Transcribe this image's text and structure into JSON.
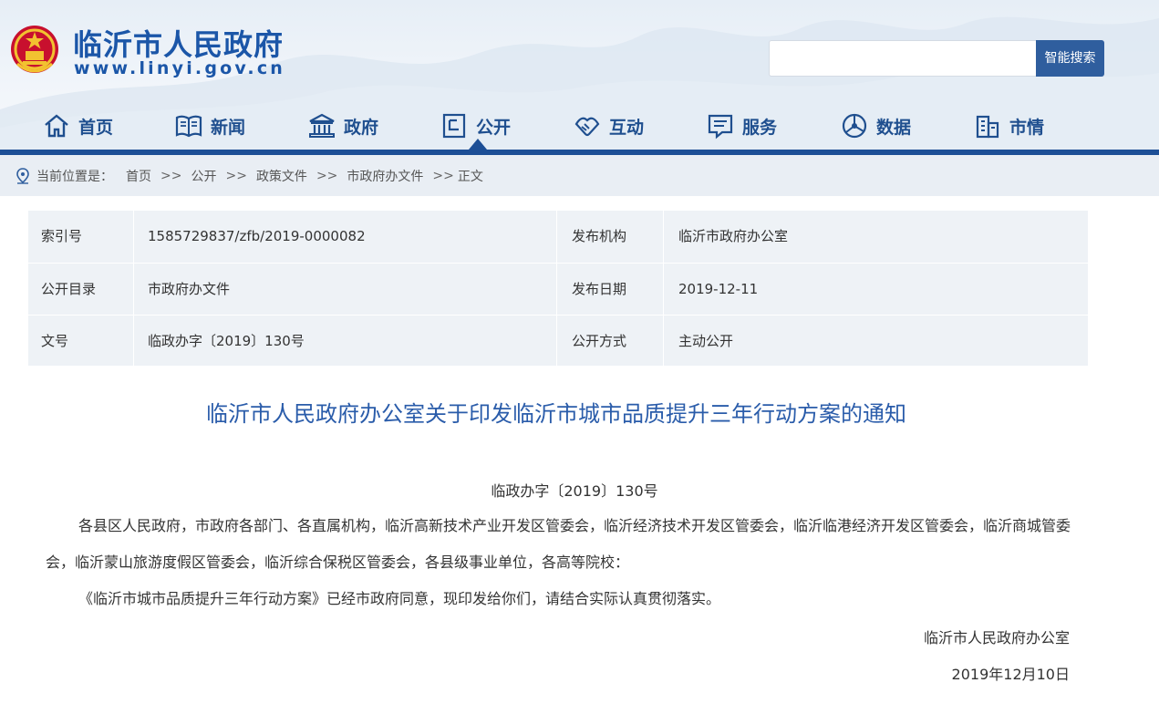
{
  "site": {
    "title": "临沂市人民政府",
    "url": "www.linyi.gov.cn"
  },
  "search": {
    "placeholder": "",
    "button_label": "智能搜索"
  },
  "nav": {
    "items": [
      {
        "label": "首页",
        "icon": "home-icon"
      },
      {
        "label": "新闻",
        "icon": "news-icon"
      },
      {
        "label": "政府",
        "icon": "government-icon"
      },
      {
        "label": "公开",
        "icon": "disclosure-icon"
      },
      {
        "label": "互动",
        "icon": "handshake-icon"
      },
      {
        "label": "服务",
        "icon": "service-icon"
      },
      {
        "label": "数据",
        "icon": "data-icon"
      },
      {
        "label": "市情",
        "icon": "city-icon"
      }
    ],
    "active_index": 3
  },
  "breadcrumb": {
    "prefix": "当前位置是：",
    "items": [
      "首页",
      "公开",
      "政策文件",
      "市政府办文件",
      "正文"
    ],
    "separator": ">>"
  },
  "info": {
    "rows": [
      {
        "label1": "索引号",
        "value1": "1585729837/zfb/2019-0000082",
        "label2": "发布机构",
        "value2": "临沂市政府办公室"
      },
      {
        "label1": "公开目录",
        "value1": "市政府办文件",
        "label2": "发布日期",
        "value2": "2019-12-11"
      },
      {
        "label1": "文号",
        "value1": "临政办字〔2019〕130号",
        "label2": "公开方式",
        "value2": "主动公开"
      }
    ]
  },
  "article": {
    "title": "临沂市人民政府办公室关于印发临沂市城市品质提升三年行动方案的通知",
    "doc_number": "临政办字〔2019〕130号",
    "paragraph1": "各县区人民政府，市政府各部门、各直属机构，临沂高新技术产业开发区管委会，临沂经济技术开发区管委会，临沂临港经济开发区管委会，临沂商城管委会，临沂蒙山旅游度假区管委会，临沂综合保税区管委会，各县级事业单位，各高等院校：",
    "paragraph2": "《临沂市城市品质提升三年行动方案》已经市政府同意，现印发给你们，请结合实际认真贯彻落实。",
    "signature_org": "临沂市人民政府办公室",
    "signature_date": "2019年12月10日"
  },
  "colors": {
    "brand_blue": "#1b56a8",
    "nav_bar": "#1d4f96",
    "search_button": "#2f5e9e",
    "title_blue": "#2a5caa"
  }
}
